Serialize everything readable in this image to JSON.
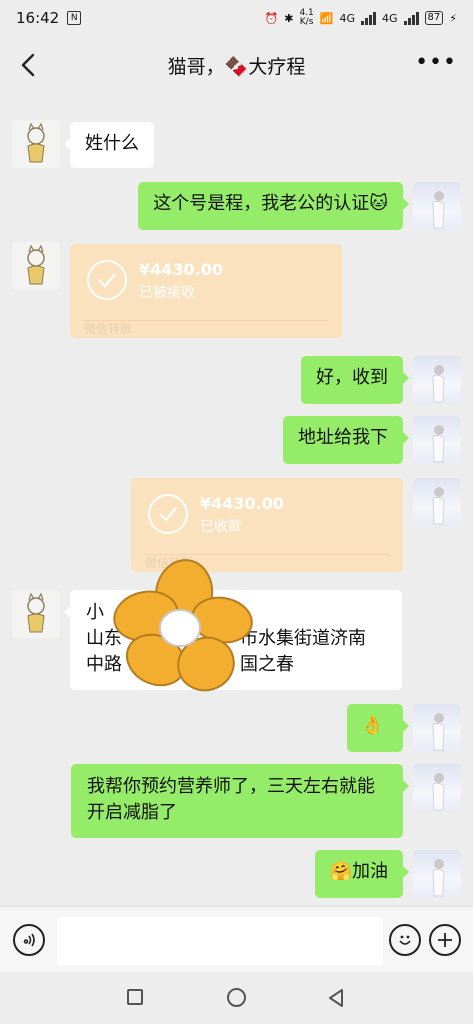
{
  "status": {
    "time": "16:42",
    "nfc": "N",
    "net_speed": "4.1",
    "net_unit": "K/s",
    "sim1": "4G",
    "sim2": "4G",
    "battery": "87"
  },
  "header": {
    "title": "猫哥，🍫大疗程"
  },
  "messages": {
    "m1": "姓什么",
    "m2": "这个号是程，我老公的认证🐱",
    "t1": {
      "amount": "¥4430.00",
      "status": "已被接收",
      "source": "微信转账"
    },
    "m3": "好，收到",
    "m4": "地址给我下",
    "t2": {
      "amount": "¥4430.00",
      "status": "已收款",
      "source": "微信转账"
    },
    "m5": {
      "line1": "小",
      "line2": "山东",
      "line2b": "市水集街道济南",
      "line3": "中路",
      "line3b": "国之春"
    },
    "m6": "👌",
    "m7": "我帮你预约营养师了，三天左右就能开启减脂了",
    "m8": "🤗加油"
  },
  "input": {
    "placeholder": ""
  },
  "colors": {
    "outgoing_bubble": "#95ec69",
    "incoming_bubble": "#ffffff",
    "transfer_card": "#fbe2be",
    "background": "#ededed"
  },
  "icons": [
    "back-arrow-icon",
    "more-icon",
    "voice-icon",
    "emoji-icon",
    "add-icon",
    "check-icon",
    "flower-sticker"
  ]
}
